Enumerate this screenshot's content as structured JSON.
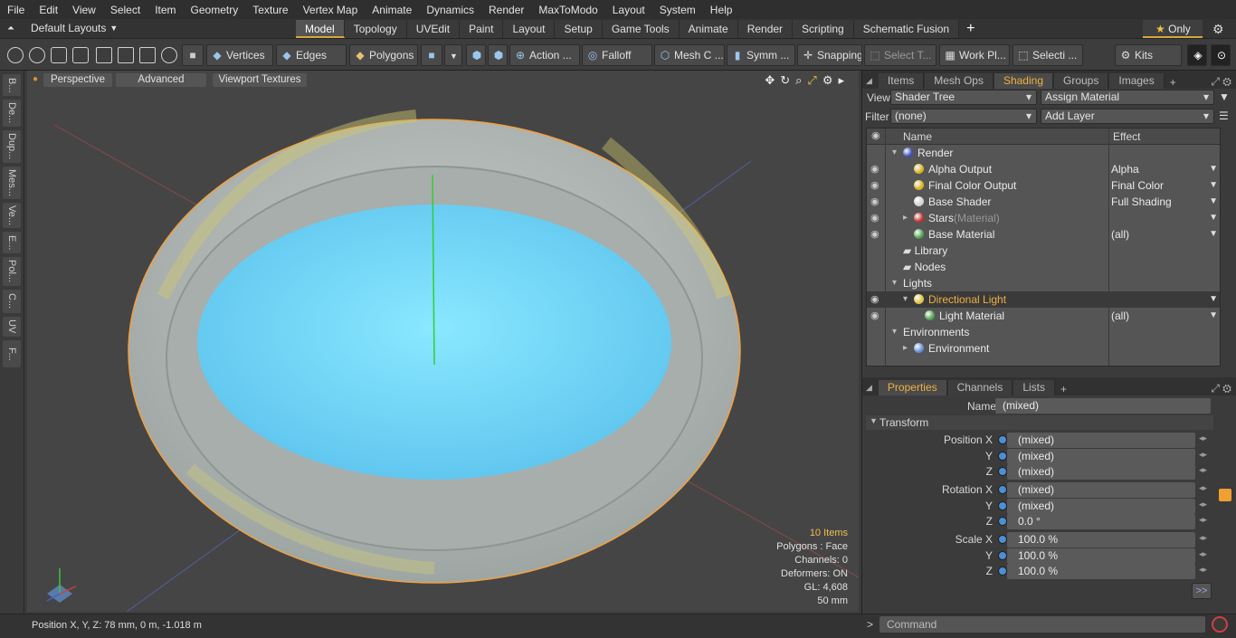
{
  "menubar": [
    "File",
    "Edit",
    "View",
    "Select",
    "Item",
    "Geometry",
    "Texture",
    "Vertex Map",
    "Animate",
    "Dynamics",
    "Render",
    "MaxToModo",
    "Layout",
    "System",
    "Help"
  ],
  "layout_selector": "Default Layouts",
  "tabs": [
    {
      "label": "Model",
      "active": true
    },
    {
      "label": "Topology"
    },
    {
      "label": "UVEdit"
    },
    {
      "label": "Paint"
    },
    {
      "label": "Layout"
    },
    {
      "label": "Setup"
    },
    {
      "label": "Game Tools"
    },
    {
      "label": "Animate"
    },
    {
      "label": "Render"
    },
    {
      "label": "Scripting"
    },
    {
      "label": "Schematic Fusion"
    }
  ],
  "only_label": "Only",
  "toolbar": {
    "vertices": "Vertices",
    "edges": "Edges",
    "polygons": "Polygons",
    "action": "Action ...",
    "falloff": "Falloff",
    "mesh": "Mesh C ...",
    "symm": "Symm ...",
    "snapping": "Snapping",
    "select_t": "Select T...",
    "work_pl": "Work Pl...",
    "selecti": "Selecti ...",
    "kits": "Kits"
  },
  "left_strip": [
    "B...",
    "De...",
    "Dup...",
    "Mes...",
    "Ve...",
    "E...",
    "Pol...",
    "C...",
    "UV",
    "F..."
  ],
  "viewport": {
    "buttons": [
      "Perspective",
      "Advanced",
      "Viewport Textures"
    ],
    "stats": {
      "items": "10 Items",
      "polygons": "Polygons : Face",
      "channels": "Channels: 0",
      "deformers": "Deformers: ON",
      "gl": "GL: 4,608",
      "scale": "50 mm"
    }
  },
  "status": {
    "position": "Position X, Y, Z:  78 mm, 0 m, -1.018 m"
  },
  "right_panel": {
    "top_tabs": [
      {
        "label": "Items"
      },
      {
        "label": "Mesh Ops"
      },
      {
        "label": "Shading",
        "active": true
      },
      {
        "label": "Groups"
      },
      {
        "label": "Images"
      }
    ],
    "view_label": "View",
    "view_value": "Shader Tree",
    "assign_material": "Assign Material",
    "filter_label": "Filter",
    "filter_value": "(none)",
    "add_layer": "Add Layer",
    "tree_headers": {
      "name": "Name",
      "effect": "Effect"
    },
    "tree_rows": [
      {
        "name": "Render",
        "indent": 0,
        "arrow": "▾",
        "swatch": "#3c4db8",
        "eye": false,
        "effect": ""
      },
      {
        "name": "Alpha Output",
        "indent": 1,
        "swatch": "#d8b020",
        "eye": true,
        "effect": "Alpha"
      },
      {
        "name": "Final Color Output",
        "indent": 1,
        "swatch": "#d8b020",
        "eye": true,
        "effect": "Final Color"
      },
      {
        "name": "Base Shader",
        "indent": 1,
        "swatch": "#d0d0d0",
        "eye": true,
        "effect": "Full Shading"
      },
      {
        "name": "Stars",
        "suffix": "(Material)",
        "indent": 1,
        "arrow": "▸",
        "swatch": "#c03030",
        "eye": true,
        "effect": ""
      },
      {
        "name": "Base Material",
        "indent": 1,
        "swatch": "#50a050",
        "eye": true,
        "effect": "(all)"
      },
      {
        "name": "Library",
        "indent": 0,
        "swatch": "",
        "eye": false,
        "effect": ""
      },
      {
        "name": "Nodes",
        "indent": 0,
        "swatch": "",
        "eye": false,
        "effect": ""
      },
      {
        "name": "Lights",
        "indent": 0,
        "arrow": "▾",
        "swatch": "",
        "eye": false,
        "effect": ""
      },
      {
        "name": "Directional Light",
        "indent": 1,
        "arrow": "▾",
        "swatch": "#e0c040",
        "eye": true,
        "effect": "",
        "selected": true
      },
      {
        "name": "Light Material",
        "indent": 2,
        "swatch": "#50a050",
        "eye": true,
        "effect": "(all)"
      },
      {
        "name": "Environments",
        "indent": 0,
        "arrow": "▾",
        "swatch": "",
        "eye": false,
        "effect": ""
      },
      {
        "name": "Environment",
        "indent": 1,
        "arrow": "▸",
        "swatch": "#6090d0",
        "eye": false,
        "effect": ""
      }
    ],
    "prop_tabs": [
      {
        "label": "Properties",
        "active": true
      },
      {
        "label": "Channels"
      },
      {
        "label": "Lists"
      }
    ],
    "name_label": "Name",
    "name_value": "(mixed)",
    "transform_label": "Transform",
    "fields": [
      {
        "label": "Position X",
        "value": "(mixed)"
      },
      {
        "label": "Y",
        "value": "(mixed)"
      },
      {
        "label": "Z",
        "value": "(mixed)"
      },
      {
        "label": "Rotation X",
        "value": "(mixed)"
      },
      {
        "label": "Y",
        "value": "(mixed)"
      },
      {
        "label": "Z",
        "value": "0.0 °"
      },
      {
        "label": "Scale X",
        "value": "100.0 %"
      },
      {
        "label": "Y",
        "value": "100.0 %"
      },
      {
        "label": "Z",
        "value": "100.0 %"
      }
    ],
    "more_button": ">>"
  },
  "command_placeholder": "Command"
}
